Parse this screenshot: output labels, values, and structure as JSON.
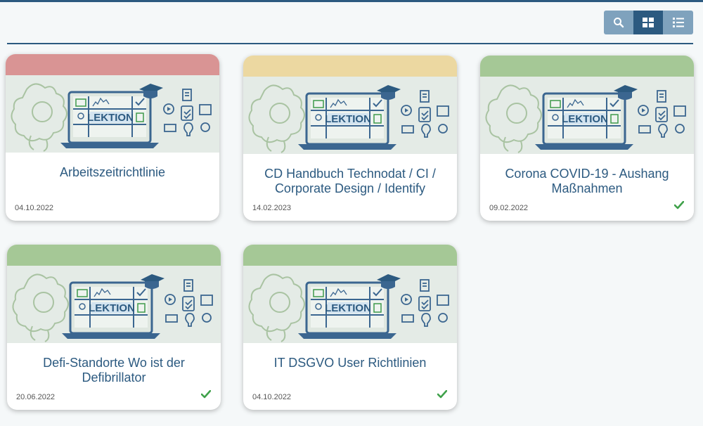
{
  "toolbar": {
    "buttons": [
      {
        "icon": "search-icon",
        "active": false
      },
      {
        "icon": "grid-view-icon",
        "active": true
      },
      {
        "icon": "list-view-icon",
        "active": false
      }
    ]
  },
  "thumbnail_label": "LEKTION",
  "colors": {
    "brand": "#2c5a80",
    "band_red": "#d99494",
    "band_yellow": "#ecd8a1",
    "band_green": "#a5c896",
    "check": "#3fa14a"
  },
  "cards": [
    {
      "title": "Arbeitszeitrichtlinie",
      "date": "04.10.2022",
      "band": "red",
      "completed": false
    },
    {
      "title": "CD Handbuch Technodat / CI / Corporate Design / Identify",
      "date": "14.02.2023",
      "band": "yellow",
      "completed": false
    },
    {
      "title": "Corona COVID-19 - Aushang Maßnahmen",
      "date": "09.02.2022",
      "band": "green",
      "completed": true
    },
    {
      "title": "Defi-Standorte Wo ist der Defibrillator",
      "date": "20.06.2022",
      "band": "green",
      "completed": true
    },
    {
      "title": "IT DSGVO User Richtlinien",
      "date": "04.10.2022",
      "band": "green",
      "completed": true
    }
  ]
}
